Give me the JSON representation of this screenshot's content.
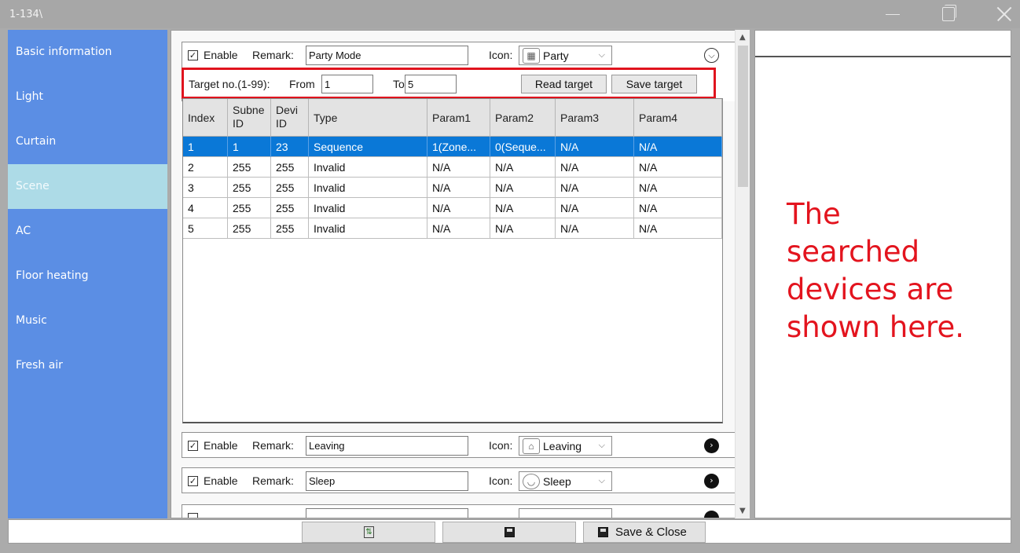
{
  "window": {
    "title": "1-134\\"
  },
  "sidebar": {
    "items": [
      {
        "label": "Basic information"
      },
      {
        "label": "Light"
      },
      {
        "label": "Curtain"
      },
      {
        "label": "Scene",
        "active": true
      },
      {
        "label": "AC"
      },
      {
        "label": "Floor heating"
      },
      {
        "label": "Music"
      },
      {
        "label": "Fresh air"
      }
    ]
  },
  "scenes": [
    {
      "enable_label": "Enable",
      "checked": true,
      "remark_label": "Remark:",
      "remark": "Party Mode",
      "icon_label": "Icon:",
      "icon_name": "Party",
      "icon": "speaker-icon",
      "expanded": true
    },
    {
      "enable_label": "Enable",
      "checked": true,
      "remark_label": "Remark:",
      "remark": "Leaving",
      "icon_label": "Icon:",
      "icon_name": "Leaving",
      "icon": "house-leaving-icon",
      "expanded": false
    },
    {
      "enable_label": "Enable",
      "checked": true,
      "remark_label": "Remark:",
      "remark": "Sleep",
      "icon_label": "Icon:",
      "icon_name": "Sleep",
      "icon": "sleep-face-icon",
      "expanded": false
    }
  ],
  "target": {
    "label": "Target no.(1-99):",
    "from_label": "From",
    "from_value": "1",
    "to_label": "To",
    "to_value": "5",
    "read_button": "Read target",
    "save_button": "Save target"
  },
  "table": {
    "columns": [
      "Index",
      "Subne ID",
      "Devi ID",
      "Type",
      "Param1",
      "Param2",
      "Param3",
      "Param4"
    ],
    "rows": [
      [
        "1",
        "1",
        "23",
        "Sequence",
        "1(Zone...",
        "0(Seque...",
        "N/A",
        "N/A"
      ],
      [
        "2",
        "255",
        "255",
        "Invalid",
        "N/A",
        "N/A",
        "N/A",
        "N/A"
      ],
      [
        "3",
        "255",
        "255",
        "Invalid",
        "N/A",
        "N/A",
        "N/A",
        "N/A"
      ],
      [
        "4",
        "255",
        "255",
        "Invalid",
        "N/A",
        "N/A",
        "N/A",
        "N/A"
      ],
      [
        "5",
        "255",
        "255",
        "Invalid",
        "N/A",
        "N/A",
        "N/A",
        "N/A"
      ]
    ],
    "selected_row": 0
  },
  "annotation": {
    "lines": [
      "The",
      "searched",
      "devices are",
      "shown here."
    ],
    "color": "#e3141e"
  },
  "bottombar": {
    "save_close": "Save & Close"
  },
  "colors": {
    "sidebar": "#5b8ee4",
    "sidebar_active": "#addbe7",
    "selection": "#0a78d7",
    "highlight": "#e0141e"
  }
}
